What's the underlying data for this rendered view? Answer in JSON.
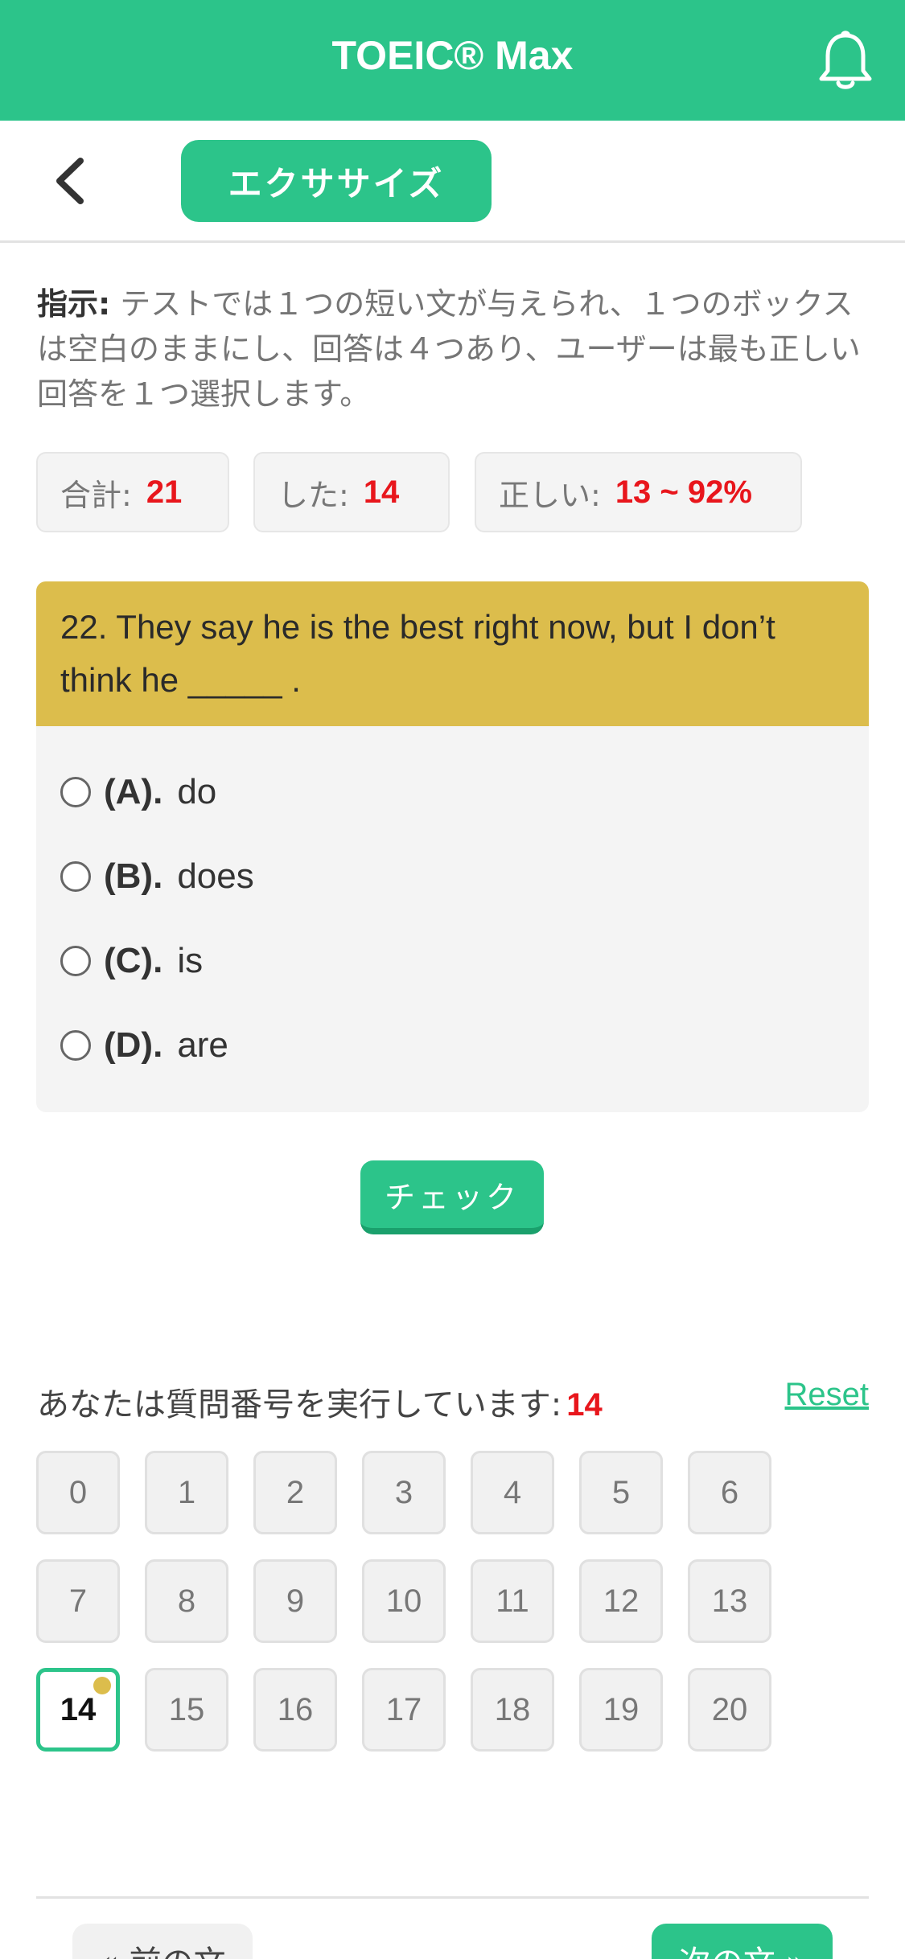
{
  "header": {
    "title": "TOEIC® Max",
    "bell_icon": "bell-icon"
  },
  "subbar": {
    "back_icon": "chevron-left-icon",
    "mode_label": "エクササイズ"
  },
  "instructions": {
    "label": "指示:",
    "text": " テストでは１つの短い文が与えられ、１つのボックスは空白のままにし、回答は４つあり、ユーザーは最も正しい回答を１つ選択します。"
  },
  "stats": {
    "total_label": "合計:",
    "total_value": "21",
    "done_label": "した:",
    "done_value": "14",
    "correct_label": "正しい:",
    "correct_value": "13 ~ 92%"
  },
  "question": {
    "text": "22. They say he is the best right now, but I don’t think he _____ .",
    "options": [
      {
        "letter": "(A).",
        "text": "do"
      },
      {
        "letter": "(B).",
        "text": "does"
      },
      {
        "letter": "(C).",
        "text": "is"
      },
      {
        "letter": "(D).",
        "text": "are"
      }
    ]
  },
  "check_button": "チェック",
  "progress": {
    "label": "あなたは質問番号を実行しています:",
    "current": "14",
    "reset": "Reset",
    "numbers": [
      "0",
      "1",
      "2",
      "3",
      "4",
      "5",
      "6",
      "7",
      "8",
      "9",
      "10",
      "11",
      "12",
      "13",
      "14",
      "15",
      "16",
      "17",
      "18",
      "19",
      "20"
    ]
  },
  "nav": {
    "prev": "« 前の文",
    "next": "次の文 »"
  },
  "colors": {
    "accent": "#2cc48a",
    "question_bg": "#dcbd4c",
    "highlight": "#e8161c"
  }
}
